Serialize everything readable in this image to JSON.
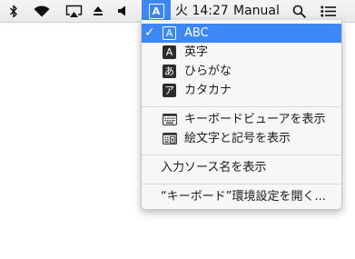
{
  "menubar": {
    "status_icons": [
      "bluetooth-icon",
      "wifi-icon",
      "airplay-icon",
      "eject-icon",
      "volume-icon"
    ],
    "ime_badge": "A",
    "clock": "火 14:27",
    "input_mode": "Manual",
    "right_icons": [
      "spotlight-search-icon",
      "notification-center-icon"
    ],
    "accent_color": "#3d88f6"
  },
  "input_menu": {
    "sources": [
      {
        "check": "✓",
        "badge": "A",
        "label": "ABC",
        "selected": true
      },
      {
        "check": "",
        "badge": "A",
        "label": "英字",
        "selected": false
      },
      {
        "check": "",
        "badge": "あ",
        "label": "ひらがな",
        "selected": false
      },
      {
        "check": "",
        "badge": "ア",
        "label": "カタカナ",
        "selected": false
      }
    ],
    "tools": [
      {
        "icon": "keyboard-viewer-icon",
        "label": "キーボードビューアを表示"
      },
      {
        "icon": "emoji-symbols-icon",
        "label": "絵文字と記号を表示"
      }
    ],
    "show_name": "入力ソース名を表示",
    "preferences": "“キーボード”環境設定を開く..."
  }
}
